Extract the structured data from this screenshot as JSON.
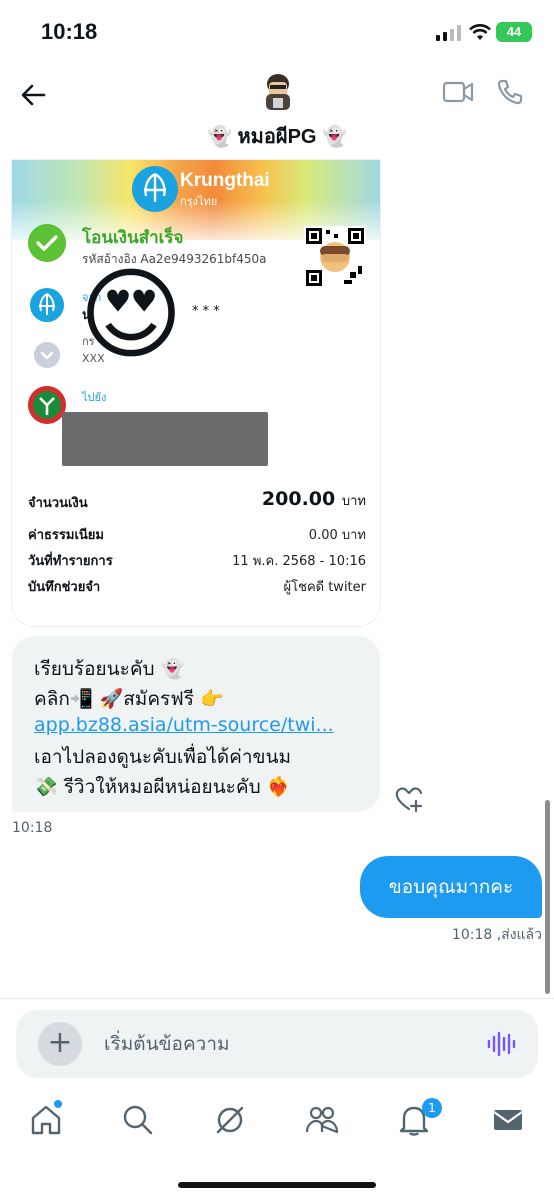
{
  "status_bar": {
    "time": "10:18",
    "battery": "44"
  },
  "header": {
    "name": "👻 หมอผีPG 👻"
  },
  "receipt": {
    "bank_name": "Krungthai",
    "bank_name_th": "กรุงไทย",
    "success_title": "โอนเงินสำเร็จ",
    "reference": "รหัสอ้างอิง Aa2e9493261bf450a",
    "from_label": "จาก",
    "from_name": "น",
    "from_name_masked": "* * *",
    "from_sub1": "กร",
    "from_sub2": "XXX",
    "to_label": "ไปยัง",
    "emoji": "😍",
    "amount_label": "จำนวนเงิน",
    "amount_value": "200.00",
    "amount_unit": "บาท",
    "fee_label": "ค่าธรรมเนียม",
    "fee_value": "0.00 บาท",
    "date_label": "วันที่ทำรายการ",
    "date_value": "11 พ.ค. 2568 - 10:16",
    "memo_label": "บันทึกช่วยจำ",
    "memo_value": "ผู้โชคดี twiter"
  },
  "message": {
    "line1": "เรียบร้อยนะคับ 👻",
    "line2": "คลิก📲 🚀สมัครฟรี 👉",
    "link": "app.bz88.asia/utm-source/twi...",
    "line4": "เอาไปลองดูนะคับเพื่อได้ค่าขนม",
    "line5": "💸 รีวิวให้หมอผีหน่อยนะคับ ❤️‍🔥",
    "time": "10:18"
  },
  "sent": {
    "text": "ขอบคุณมากคะ",
    "status": "10:18 ,ส่งแล้ว"
  },
  "composer": {
    "placeholder": "เริ่มต้นข้อความ"
  },
  "tabs": {
    "notifications_badge": "1"
  },
  "colors": {
    "accent": "#1d9bf0",
    "success": "#3aa72c",
    "bubble_in": "#eff3f4"
  }
}
